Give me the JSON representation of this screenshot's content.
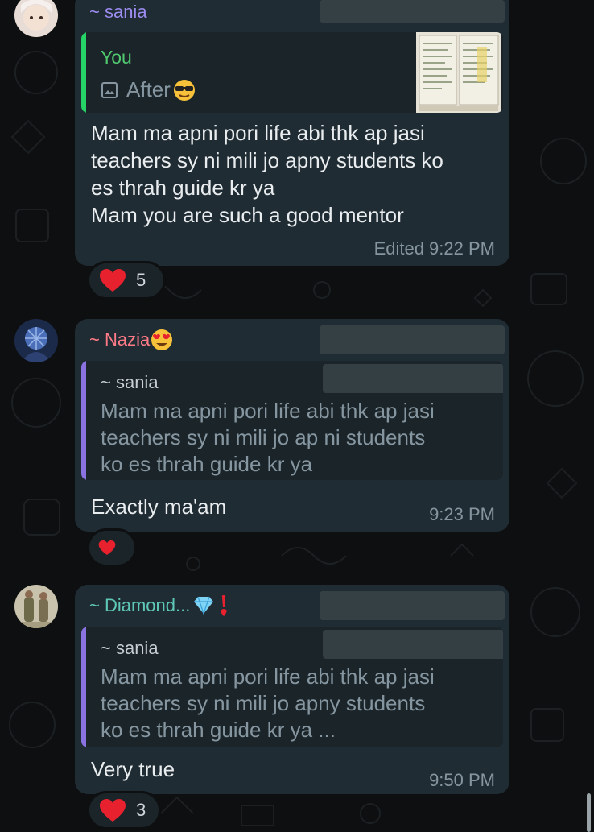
{
  "messages": [
    {
      "sender": "~ sania",
      "sender_color": "#9c8cf0",
      "reply": {
        "name": "You",
        "name_color": "#51c96f",
        "bar_color": "#25d366",
        "media_icon": "image-icon",
        "text": "After",
        "emoji": "sunglasses-emoji"
      },
      "text_lines": [
        "Mam ma apni  pori life abi thk  ap jasi",
        "teachers sy ni mili  jo apny students  ko",
        "es thrah guide kr ya",
        "Mam you are such a good mentor"
      ],
      "time": "Edited 9:22 PM",
      "reaction": {
        "emoji": "heart-icon",
        "count": "5"
      }
    },
    {
      "sender": "~ Nazia",
      "sender_color": "#ff7b87",
      "sender_emoji": "heart-eyes-emoji",
      "reply": {
        "name": "~ sania",
        "name_color": "#c9cfd3",
        "bar_color": "#8a72e0",
        "text_lines": [
          "Mam ma apni  pori life abi thk  ap jasi",
          "teachers sy ni mili  jo ap ni students",
          "ko es thrah guide kr ya"
        ]
      },
      "text_lines": [
        "Exactly ma'am"
      ],
      "time": "9:23 PM",
      "reaction": {
        "emoji": "heart-icon",
        "count": ""
      }
    },
    {
      "sender": "~ Diamond...",
      "sender_color": "#5ec9b8",
      "sender_emoji": "gem-and-exclamation-emoji",
      "reply": {
        "name": "~ sania",
        "name_color": "#c9cfd3",
        "bar_color": "#8a72e0",
        "text_lines": [
          "Mam ma apni  pori life abi thk  ap jasi",
          "teachers sy ni mili  jo apny students",
          "ko es thrah guide kr ya ..."
        ]
      },
      "text_lines": [
        "Very true"
      ],
      "time": "9:50 PM",
      "reaction": {
        "emoji": "heart-icon",
        "count": "3"
      }
    }
  ]
}
